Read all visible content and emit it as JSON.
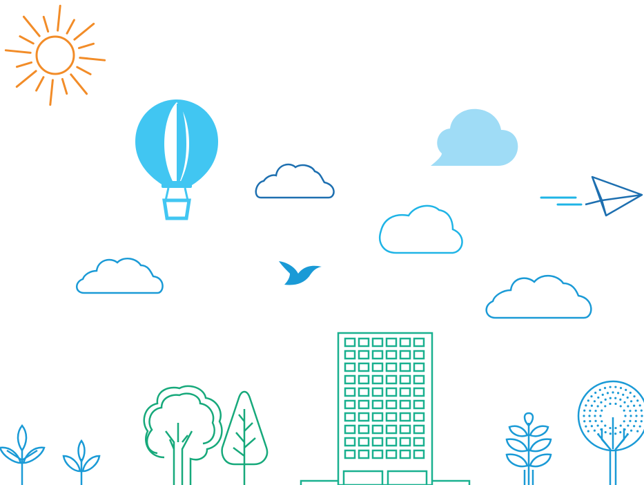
{
  "colors": {
    "sun": "#f28c28",
    "balloon": "#41c6f2",
    "cloud_filled": "#9fdcf6",
    "cloud_dark": "#1d6fb0",
    "cloud_light": "#1fb4e6",
    "cloud_mid": "#1a9ad6",
    "plane": "#1d6fb0",
    "plane_lines": "#1fb4e6",
    "bird": "#1a9ad6",
    "building": "#19b08f",
    "trees_green": "#17a97b",
    "plants_blue": "#1a9ad6",
    "background": "#ffffff"
  },
  "icons": [
    "sun-icon",
    "hot-air-balloon-icon",
    "cloud-icon",
    "paper-plane-icon",
    "bird-icon",
    "office-building-icon",
    "tree-icon",
    "sprout-icon"
  ]
}
